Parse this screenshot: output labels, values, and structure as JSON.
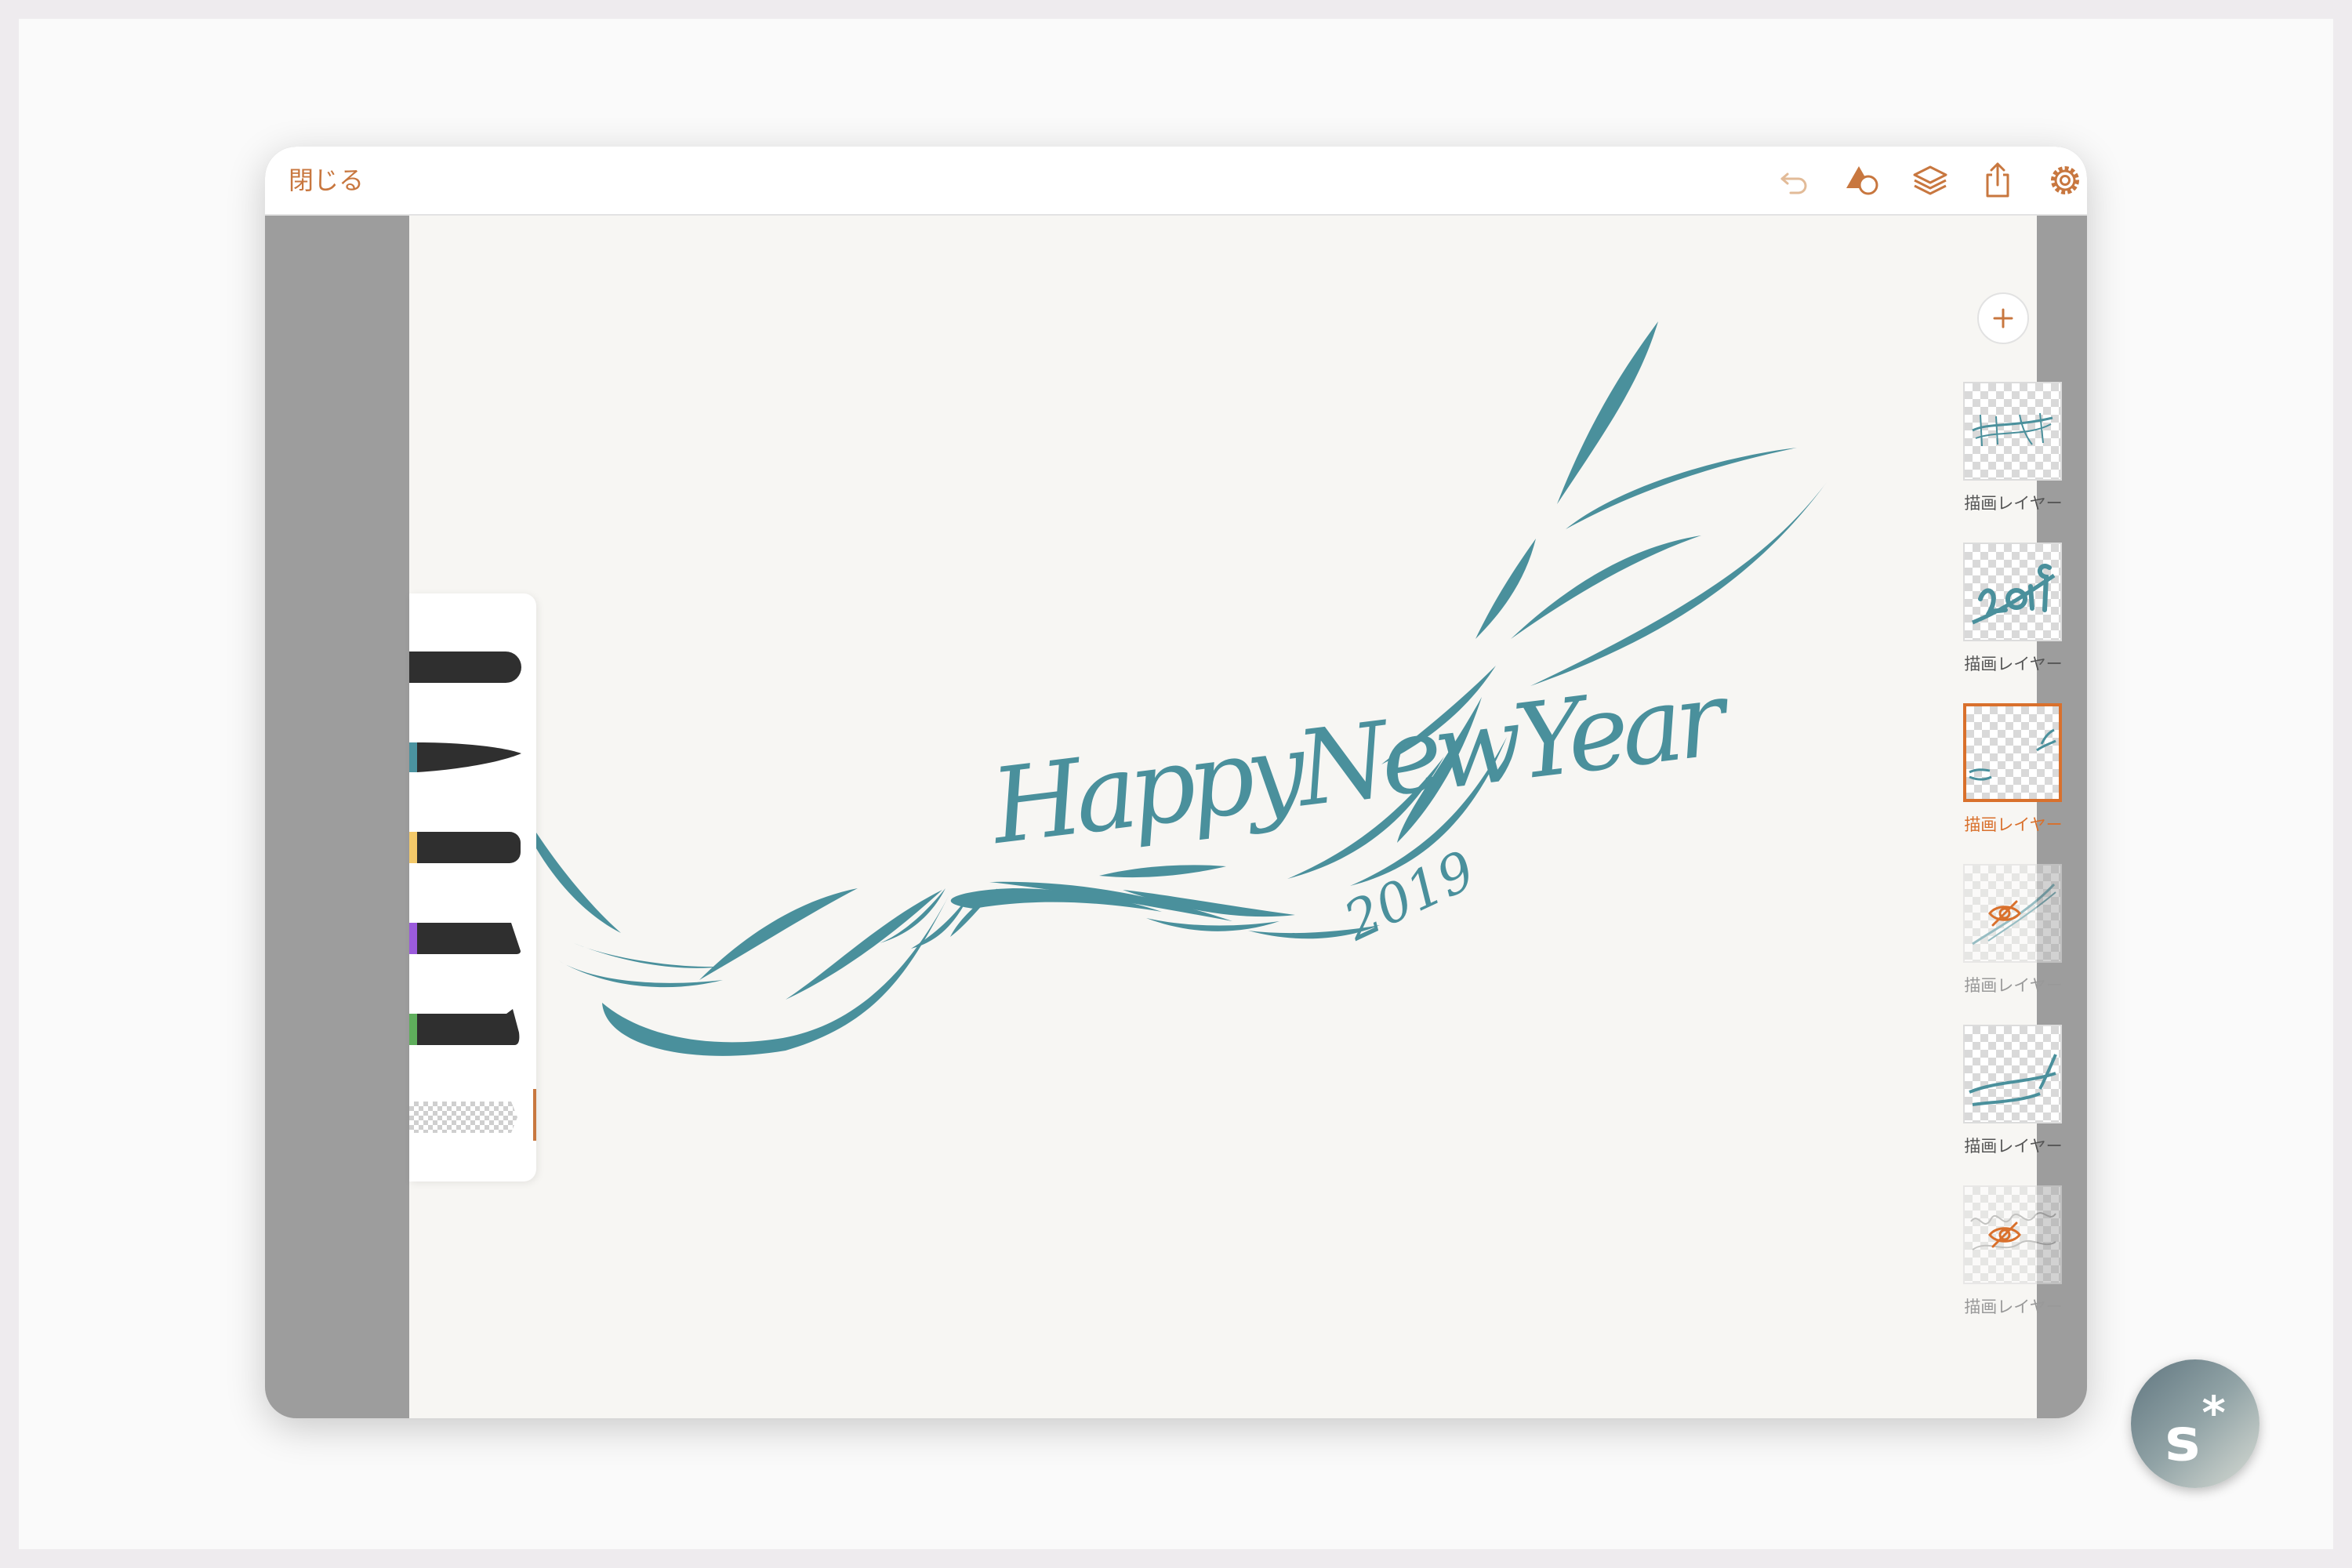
{
  "topbar": {
    "close_label": "閉じる",
    "icons": [
      "undo-icon",
      "shapes-icon",
      "layers-icon",
      "share-icon",
      "gear-icon",
      "expand-icon"
    ]
  },
  "brushes": [
    {
      "name": "round-brush",
      "accent": "#3a3a3a"
    },
    {
      "name": "pen-brush",
      "accent": "#4b93a0"
    },
    {
      "name": "marker-brush",
      "accent": "#f3c96a"
    },
    {
      "name": "flat-brush",
      "accent": "#9b5bdc"
    },
    {
      "name": "chisel-brush",
      "accent": "#5fae5c"
    },
    {
      "name": "eraser-brush",
      "accent": "#cfcfcf"
    }
  ],
  "layers": [
    {
      "label": "描画レイヤー",
      "state": "visible"
    },
    {
      "label": "描画レイヤー",
      "state": "visible"
    },
    {
      "label": "描画レイヤー",
      "state": "selected"
    },
    {
      "label": "描画レイヤー",
      "state": "hidden"
    },
    {
      "label": "描画レイヤー",
      "state": "visible"
    },
    {
      "label": "描画レイヤー",
      "state": "hidden"
    }
  ],
  "artwork": {
    "text_main": "HappyNewYear",
    "text_year": "2019",
    "ink_color": "#4a909c"
  },
  "colors": {
    "accent": "#c8773f",
    "selected": "#d9702c",
    "ink": "#4a909c"
  },
  "badge": {
    "letter": "s",
    "mark": "*"
  }
}
